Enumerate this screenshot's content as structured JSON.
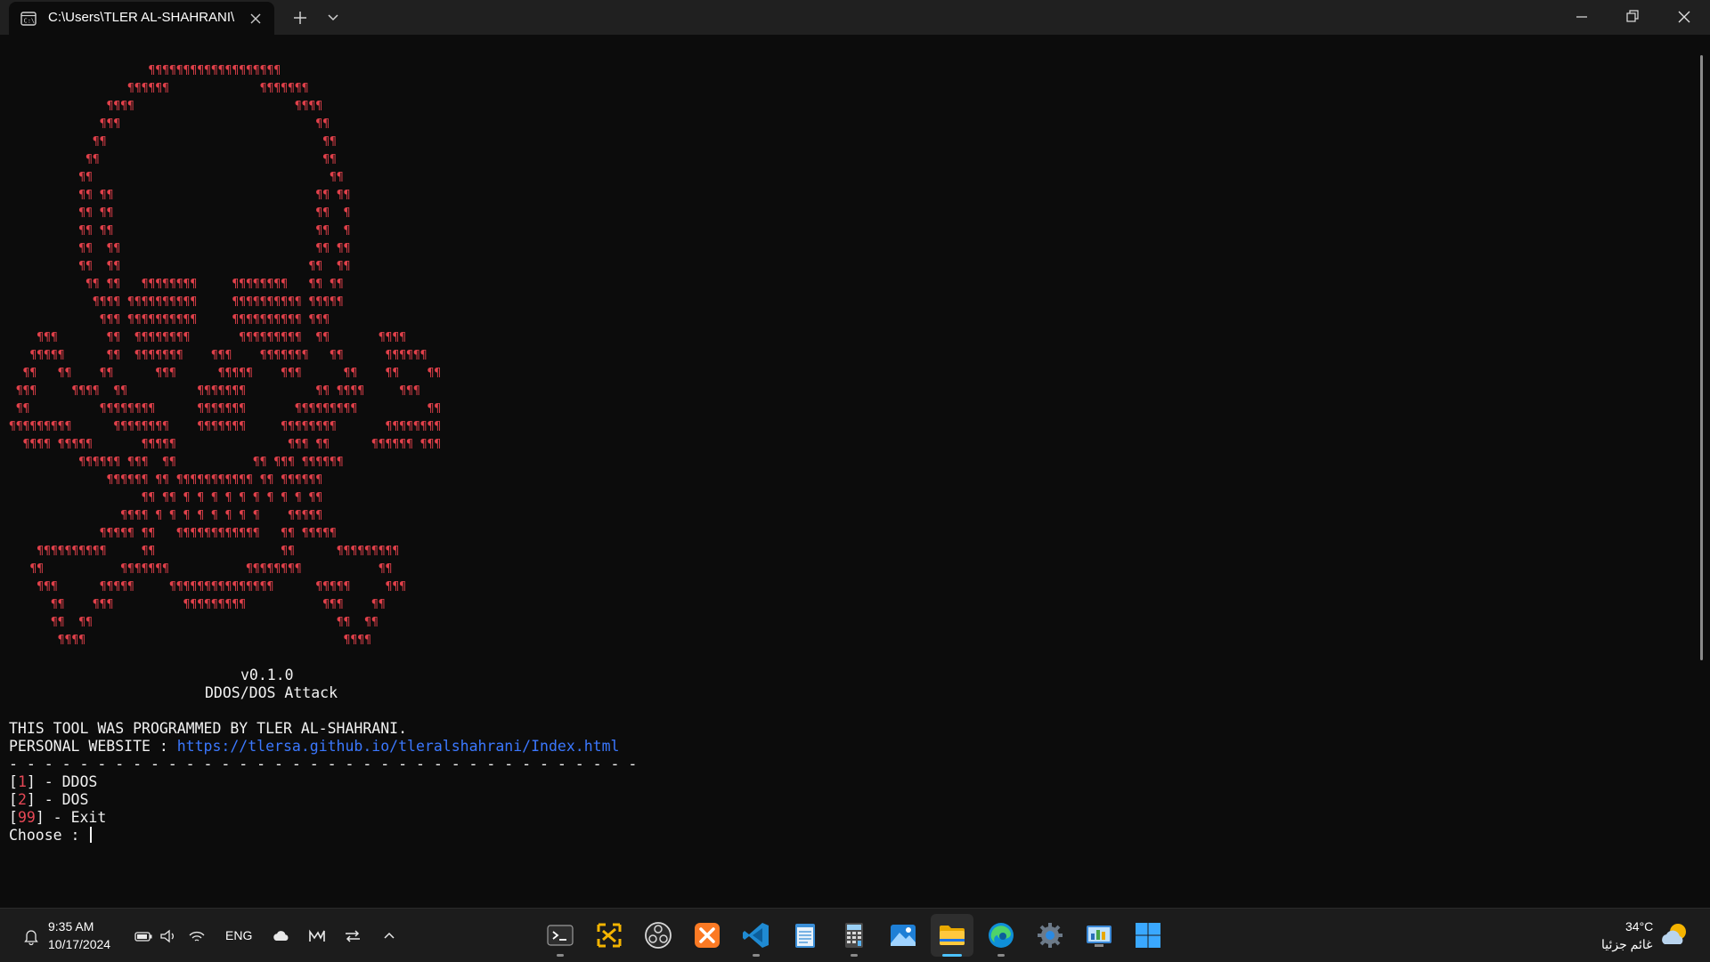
{
  "window": {
    "tab_title": "C:\\Users\\TLER AL-SHAHRANI\\",
    "tab_icon": "terminal-icon",
    "new_tab_label": "+",
    "dropdown_icon": "chevron-down-icon",
    "controls": [
      "minimize-icon",
      "restore-icon",
      "close-icon"
    ]
  },
  "terminal": {
    "colors": {
      "background": "#0c0c0c",
      "text": "#f2f2f2",
      "art": "#e0404a",
      "link": "#3b78ff",
      "number": "#e74856"
    },
    "art_lines": [
      "                    ¶¶¶¶¶¶¶¶¶¶¶¶¶¶¶¶¶¶¶",
      "                 ¶¶¶¶¶¶             ¶¶¶¶¶¶¶",
      "              ¶¶¶¶                       ¶¶¶¶",
      "             ¶¶¶                            ¶¶",
      "            ¶¶                               ¶¶",
      "           ¶¶                                ¶¶",
      "          ¶¶                                  ¶¶",
      "          ¶¶ ¶¶                             ¶¶ ¶¶",
      "          ¶¶ ¶¶                             ¶¶  ¶",
      "          ¶¶ ¶¶                             ¶¶  ¶",
      "          ¶¶  ¶¶                            ¶¶ ¶¶",
      "          ¶¶  ¶¶                           ¶¶  ¶¶",
      "           ¶¶ ¶¶   ¶¶¶¶¶¶¶¶     ¶¶¶¶¶¶¶¶   ¶¶ ¶¶",
      "            ¶¶¶¶ ¶¶¶¶¶¶¶¶¶¶     ¶¶¶¶¶¶¶¶¶¶ ¶¶¶¶¶",
      "             ¶¶¶ ¶¶¶¶¶¶¶¶¶¶     ¶¶¶¶¶¶¶¶¶¶ ¶¶¶",
      "    ¶¶¶       ¶¶  ¶¶¶¶¶¶¶¶       ¶¶¶¶¶¶¶¶¶  ¶¶       ¶¶¶¶",
      "   ¶¶¶¶¶      ¶¶  ¶¶¶¶¶¶¶    ¶¶¶    ¶¶¶¶¶¶¶   ¶¶      ¶¶¶¶¶¶",
      "  ¶¶   ¶¶    ¶¶      ¶¶¶      ¶¶¶¶¶    ¶¶¶      ¶¶    ¶¶    ¶¶",
      " ¶¶¶     ¶¶¶¶  ¶¶          ¶¶¶¶¶¶¶          ¶¶ ¶¶¶¶     ¶¶¶",
      " ¶¶          ¶¶¶¶¶¶¶¶      ¶¶¶¶¶¶¶       ¶¶¶¶¶¶¶¶¶          ¶¶",
      "¶¶¶¶¶¶¶¶¶      ¶¶¶¶¶¶¶¶    ¶¶¶¶¶¶¶     ¶¶¶¶¶¶¶¶       ¶¶¶¶¶¶¶¶",
      "  ¶¶¶¶ ¶¶¶¶¶       ¶¶¶¶¶                ¶¶¶ ¶¶      ¶¶¶¶¶¶ ¶¶¶",
      "          ¶¶¶¶¶¶ ¶¶¶  ¶¶           ¶¶ ¶¶¶ ¶¶¶¶¶¶",
      "              ¶¶¶¶¶¶ ¶¶ ¶¶¶¶¶¶¶¶¶¶¶ ¶¶ ¶¶¶¶¶¶",
      "                   ¶¶ ¶¶ ¶ ¶ ¶ ¶ ¶ ¶ ¶ ¶ ¶ ¶¶",
      "                ¶¶¶¶ ¶ ¶ ¶ ¶ ¶ ¶ ¶ ¶    ¶¶¶¶¶",
      "             ¶¶¶¶¶ ¶¶   ¶¶¶¶¶¶¶¶¶¶¶¶   ¶¶ ¶¶¶¶¶",
      "    ¶¶¶¶¶¶¶¶¶¶     ¶¶                  ¶¶      ¶¶¶¶¶¶¶¶¶",
      "   ¶¶           ¶¶¶¶¶¶¶           ¶¶¶¶¶¶¶¶           ¶¶",
      "    ¶¶¶      ¶¶¶¶¶     ¶¶¶¶¶¶¶¶¶¶¶¶¶¶¶      ¶¶¶¶¶     ¶¶¶",
      "      ¶¶    ¶¶¶          ¶¶¶¶¶¶¶¶¶           ¶¶¶    ¶¶",
      "      ¶¶  ¶¶                                   ¶¶  ¶¶",
      "       ¶¶¶¶                                     ¶¶¶¶"
    ],
    "version": "v0.1.0",
    "subtitle": "DDOS/DOS Attack",
    "credit": "THIS TOOL WAS PROGRAMMED BY TLER AL-SHAHRANI.",
    "website_label": "PERSONAL WEBSITE : ",
    "website_url": "https://tlersa.github.io/tleralshahrani/Index.html",
    "separator": "- - - - - - - - - - - - - - - - - - - - - - - - - - - - - - - - - - - -",
    "menu": [
      {
        "number": "1",
        "label": "DDOS"
      },
      {
        "number": "2",
        "label": "DOS"
      },
      {
        "number": "99",
        "label": "Exit"
      }
    ],
    "prompt": "Choose : "
  },
  "taskbar": {
    "time": "9:35 AM",
    "date": "10/17/2024",
    "language": "ENG",
    "weather_temp": "34°C",
    "weather_desc": "غائم جزئيا",
    "tray_icons": [
      "bell-icon",
      "battery-icon",
      "volume-icon",
      "wifi-icon",
      "onedrive-cloud-icon",
      "task-manager-icon",
      "sync-icon",
      "chevron-up-icon"
    ],
    "apps": [
      {
        "name": "terminal-app-icon",
        "running": true
      },
      {
        "name": "snipping-tool-app-icon",
        "running": false
      },
      {
        "name": "obs-app-icon",
        "running": false
      },
      {
        "name": "xampp-app-icon",
        "running": false
      },
      {
        "name": "vscode-app-icon",
        "running": true
      },
      {
        "name": "notepad-app-icon",
        "running": false
      },
      {
        "name": "calculator-app-icon",
        "running": true
      },
      {
        "name": "photos-app-icon",
        "running": false
      },
      {
        "name": "file-explorer-app-icon",
        "running": true,
        "active": true
      },
      {
        "name": "edge-app-icon",
        "running": true
      },
      {
        "name": "settings-app-icon",
        "running": false
      },
      {
        "name": "control-panel-app-icon",
        "running": false
      },
      {
        "name": "start-button-icon",
        "running": false
      }
    ]
  }
}
